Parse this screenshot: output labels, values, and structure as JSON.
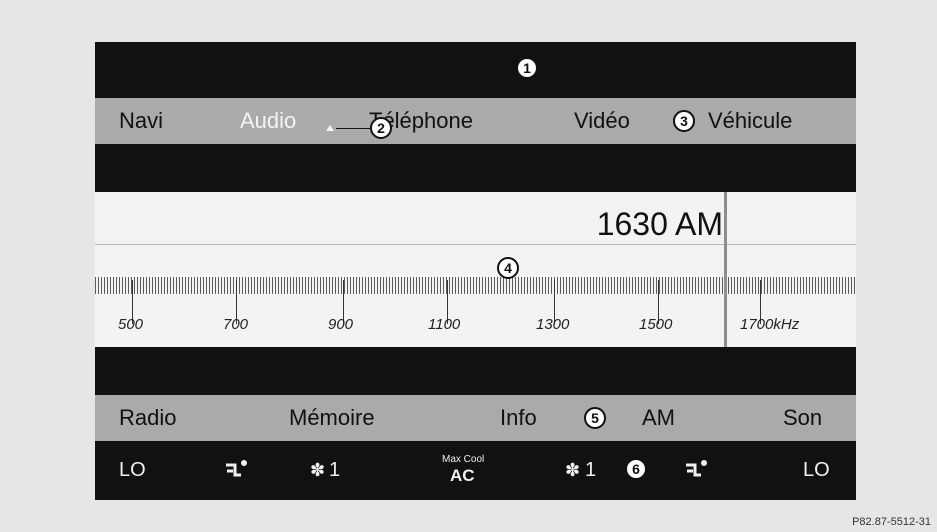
{
  "menu": {
    "items": [
      {
        "label": "Navi"
      },
      {
        "label": "Audio"
      },
      {
        "label": "Téléphone"
      },
      {
        "label": "Vidéo"
      },
      {
        "label": "Véhicule"
      }
    ],
    "active": "Audio"
  },
  "tuner": {
    "frequency": "1630 AM",
    "scale_labels": [
      "500",
      "700",
      "900",
      "1100",
      "1300",
      "1500",
      "1700kHz"
    ]
  },
  "softkeys": {
    "items": [
      {
        "label": "Radio"
      },
      {
        "label": "Mémoire"
      },
      {
        "label": "Info"
      },
      {
        "label": "AM"
      },
      {
        "label": "Son"
      }
    ]
  },
  "climate": {
    "left_temp": "LO",
    "left_fan": "1",
    "ac_top": "Max Cool",
    "ac_bottom": "AC",
    "right_fan": "1",
    "right_temp": "LO",
    "airflow_icon": "airflow-icon",
    "fan_icon": "fan-icon"
  },
  "callouts": [
    "1",
    "2",
    "3",
    "4",
    "5",
    "6"
  ],
  "caption": "P82.87-5512-31",
  "colors": {
    "screen_bg": "#111111",
    "bar_bg": "#aaaaaa",
    "tuner_bg": "#f3f3f3",
    "page_bg": "#e6e6e6"
  }
}
